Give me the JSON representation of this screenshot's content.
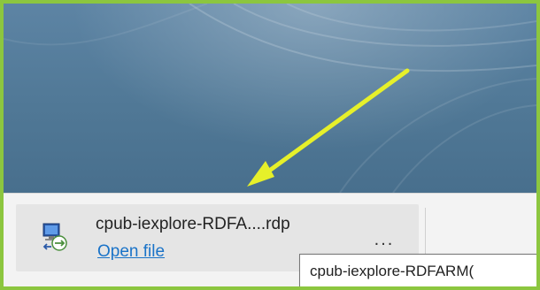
{
  "downloads": {
    "item": {
      "icon": "rdp-file-icon",
      "filename": "cpub-iexplore-RDFA....rdp",
      "open_link": "Open file",
      "more_label": "..."
    },
    "tooltip": "cpub-iexplore-RDFARM("
  },
  "annotation": {
    "arrow_color": "#e6f02a",
    "border_color": "#8cc63f"
  },
  "desktop": {
    "wallpaper_color": "#507896"
  }
}
